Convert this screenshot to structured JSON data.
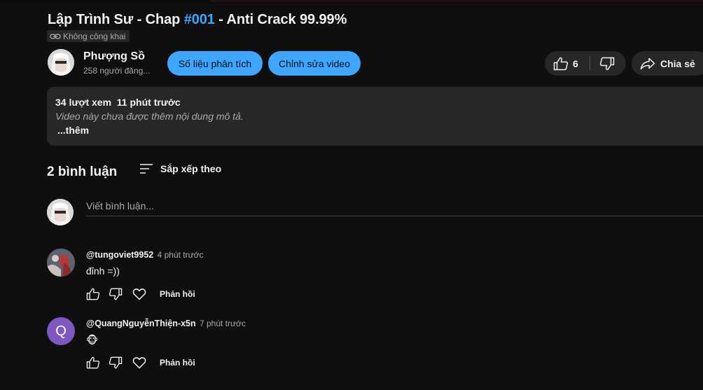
{
  "video": {
    "title_prefix": "Lập Trình Sư - Chap ",
    "title_hash": "#001",
    "title_suffix": " - Anti Crack 99.99%",
    "privacy": "Không công khai"
  },
  "channel": {
    "name": "Phượng Sồ",
    "subscribers": "258 người đăng..."
  },
  "buttons": {
    "analytics": "Số liệu phân tích",
    "edit": "Chỉnh sửa video",
    "share": "Chia sẻ"
  },
  "likes": {
    "count": "6"
  },
  "description": {
    "stats": "34 lượt xem  11 phút trước",
    "text": "Video này chưa được thêm nội dung mô tả.",
    "more": "...thêm"
  },
  "comments_section": {
    "count_label": "2 bình luận",
    "sort_label": "Sắp xếp theo",
    "add_placeholder": "Viết bình luận..."
  },
  "comments": [
    {
      "author": "@tungoviet9952",
      "time": "4 phút trước",
      "text": "đỉnh =))",
      "reply": "Phản hồi"
    },
    {
      "author": "@QuangNguyễnThiện-x5n",
      "time": "7 phút trước",
      "avatar_letter": "Q",
      "emoji": "🐵",
      "reply": "Phản hồi"
    }
  ],
  "colors": {
    "background": "#0f0f0f",
    "accent": "#3ea6ff",
    "surface": "#272727",
    "avatar_purple": "#7e57c2"
  }
}
